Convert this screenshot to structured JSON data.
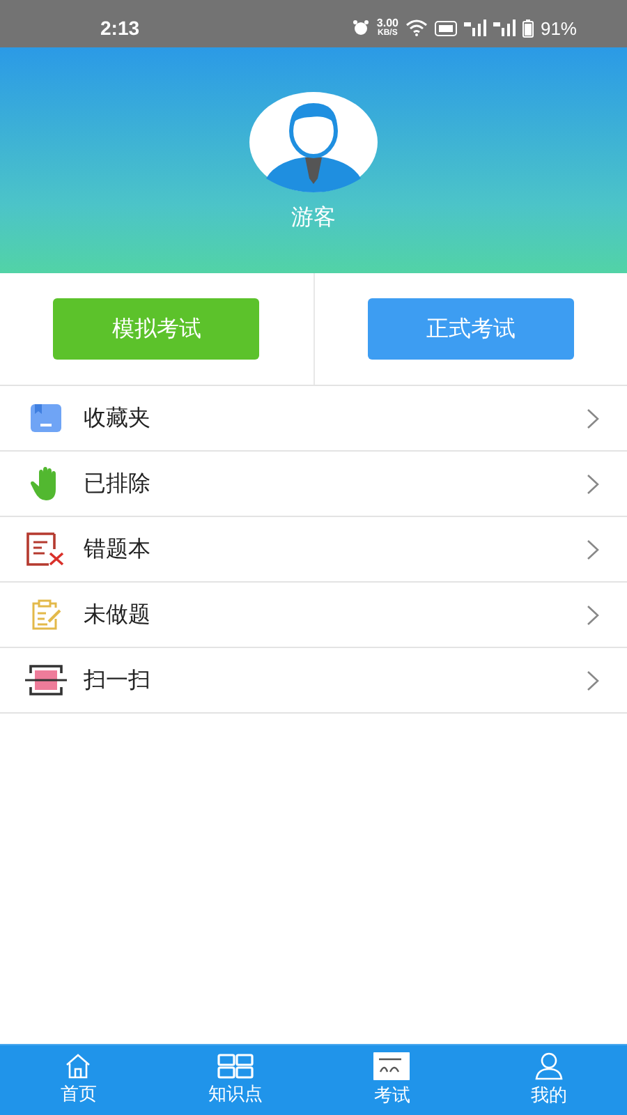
{
  "status_bar": {
    "time": "2:13",
    "speed": "3.00",
    "speed_unit": "KB/S",
    "battery": "91%"
  },
  "profile": {
    "name": "游客"
  },
  "exam_buttons": [
    {
      "label": "模拟考试",
      "kind": "practice"
    },
    {
      "label": "正式考试",
      "kind": "formal"
    }
  ],
  "menu": [
    {
      "label": "收藏夹",
      "kind": "favorites"
    },
    {
      "label": "已排除",
      "kind": "excluded"
    },
    {
      "label": "错题本",
      "kind": "wrong"
    },
    {
      "label": "未做题",
      "kind": "undone"
    },
    {
      "label": "扫一扫",
      "kind": "scan"
    }
  ],
  "bottom_nav": [
    {
      "label": "首页",
      "kind": "home"
    },
    {
      "label": "知识点",
      "kind": "knowledge"
    },
    {
      "label": "考试",
      "kind": "exam"
    },
    {
      "label": "我的",
      "kind": "me"
    }
  ]
}
